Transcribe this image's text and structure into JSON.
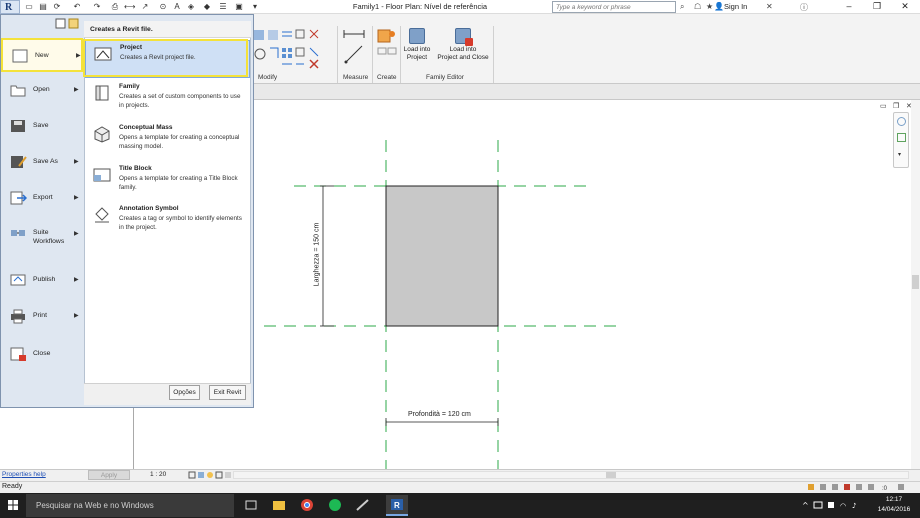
{
  "window": {
    "title": "Family1 - Floor Plan: Nível de referência",
    "search_placeholder": "Type a keyword or phrase",
    "sign_in": "Sign In"
  },
  "ribbon": {
    "panels": [
      "Modify",
      "Measure",
      "Create",
      "Family Editor"
    ],
    "load_into_project": "Load into\nProject",
    "load_into_project_and_close": "Load into\nProject and Close"
  },
  "app_menu": {
    "items": [
      {
        "label": "New",
        "icon": "new-file-icon"
      },
      {
        "label": "Open",
        "icon": "open-folder-icon"
      },
      {
        "label": "Save",
        "icon": "save-disk-icon"
      },
      {
        "label": "Save As",
        "icon": "save-as-icon"
      },
      {
        "label": "Export",
        "icon": "export-icon"
      },
      {
        "label": "Suite\nWorkflows",
        "icon": "suite-workflows-icon"
      },
      {
        "label": "Publish",
        "icon": "publish-icon"
      },
      {
        "label": "Print",
        "icon": "print-icon"
      },
      {
        "label": "Close",
        "icon": "close-file-icon"
      }
    ],
    "submenu_title": "Creates a Revit file.",
    "submenu_items": [
      {
        "title": "Project",
        "desc": "Creates a Revit project file."
      },
      {
        "title": "Family",
        "desc": "Creates a set of custom components to use in projects."
      },
      {
        "title": "Conceptual Mass",
        "desc": "Opens a template for creating a conceptual massing model."
      },
      {
        "title": "Title Block",
        "desc": "Opens a template for creating a Title Block family."
      },
      {
        "title": "Annotation Symbol",
        "desc": "Creates a tag or symbol to identify elements in the project."
      }
    ],
    "options_label": "Opções",
    "exit_label": "Exit Revit"
  },
  "properties": {
    "help_link": "Properties help",
    "apply_label": "Apply"
  },
  "view": {
    "scale": "1 : 20",
    "dim_width": "Profondità = 120 cm",
    "dim_height": "Larghezza = 150 cm"
  },
  "status": {
    "text": "Ready"
  },
  "taskbar": {
    "search_placeholder": "Pesquisar na Web e no Windows",
    "time": "12:17",
    "date": "14/04/2016"
  },
  "colors": {
    "ref_plane": "#2ea84a",
    "rect_fill": "#c8c8c8",
    "highlight": "#f4e23a",
    "selected_bg": "#cfe0f5"
  }
}
